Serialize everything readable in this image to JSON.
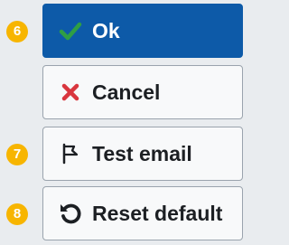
{
  "buttons": [
    {
      "badge": "6",
      "label": "Ok",
      "icon": "check-icon",
      "icon_color": "#2f9e44",
      "style": "primary"
    },
    {
      "badge": "",
      "label": "Cancel",
      "icon": "x-icon",
      "icon_color": "#d9363e",
      "style": "secondary"
    },
    {
      "badge": "7",
      "label": "Test email",
      "icon": "flag-icon",
      "icon_color": "#1c1f23",
      "style": "secondary"
    },
    {
      "badge": "8",
      "label": "Reset default",
      "icon": "undo-icon",
      "icon_color": "#1c1f23",
      "style": "secondary"
    }
  ],
  "colors": {
    "background": "#e9ecef",
    "primary": "#0d5aa8",
    "badge": "#f7b500"
  }
}
